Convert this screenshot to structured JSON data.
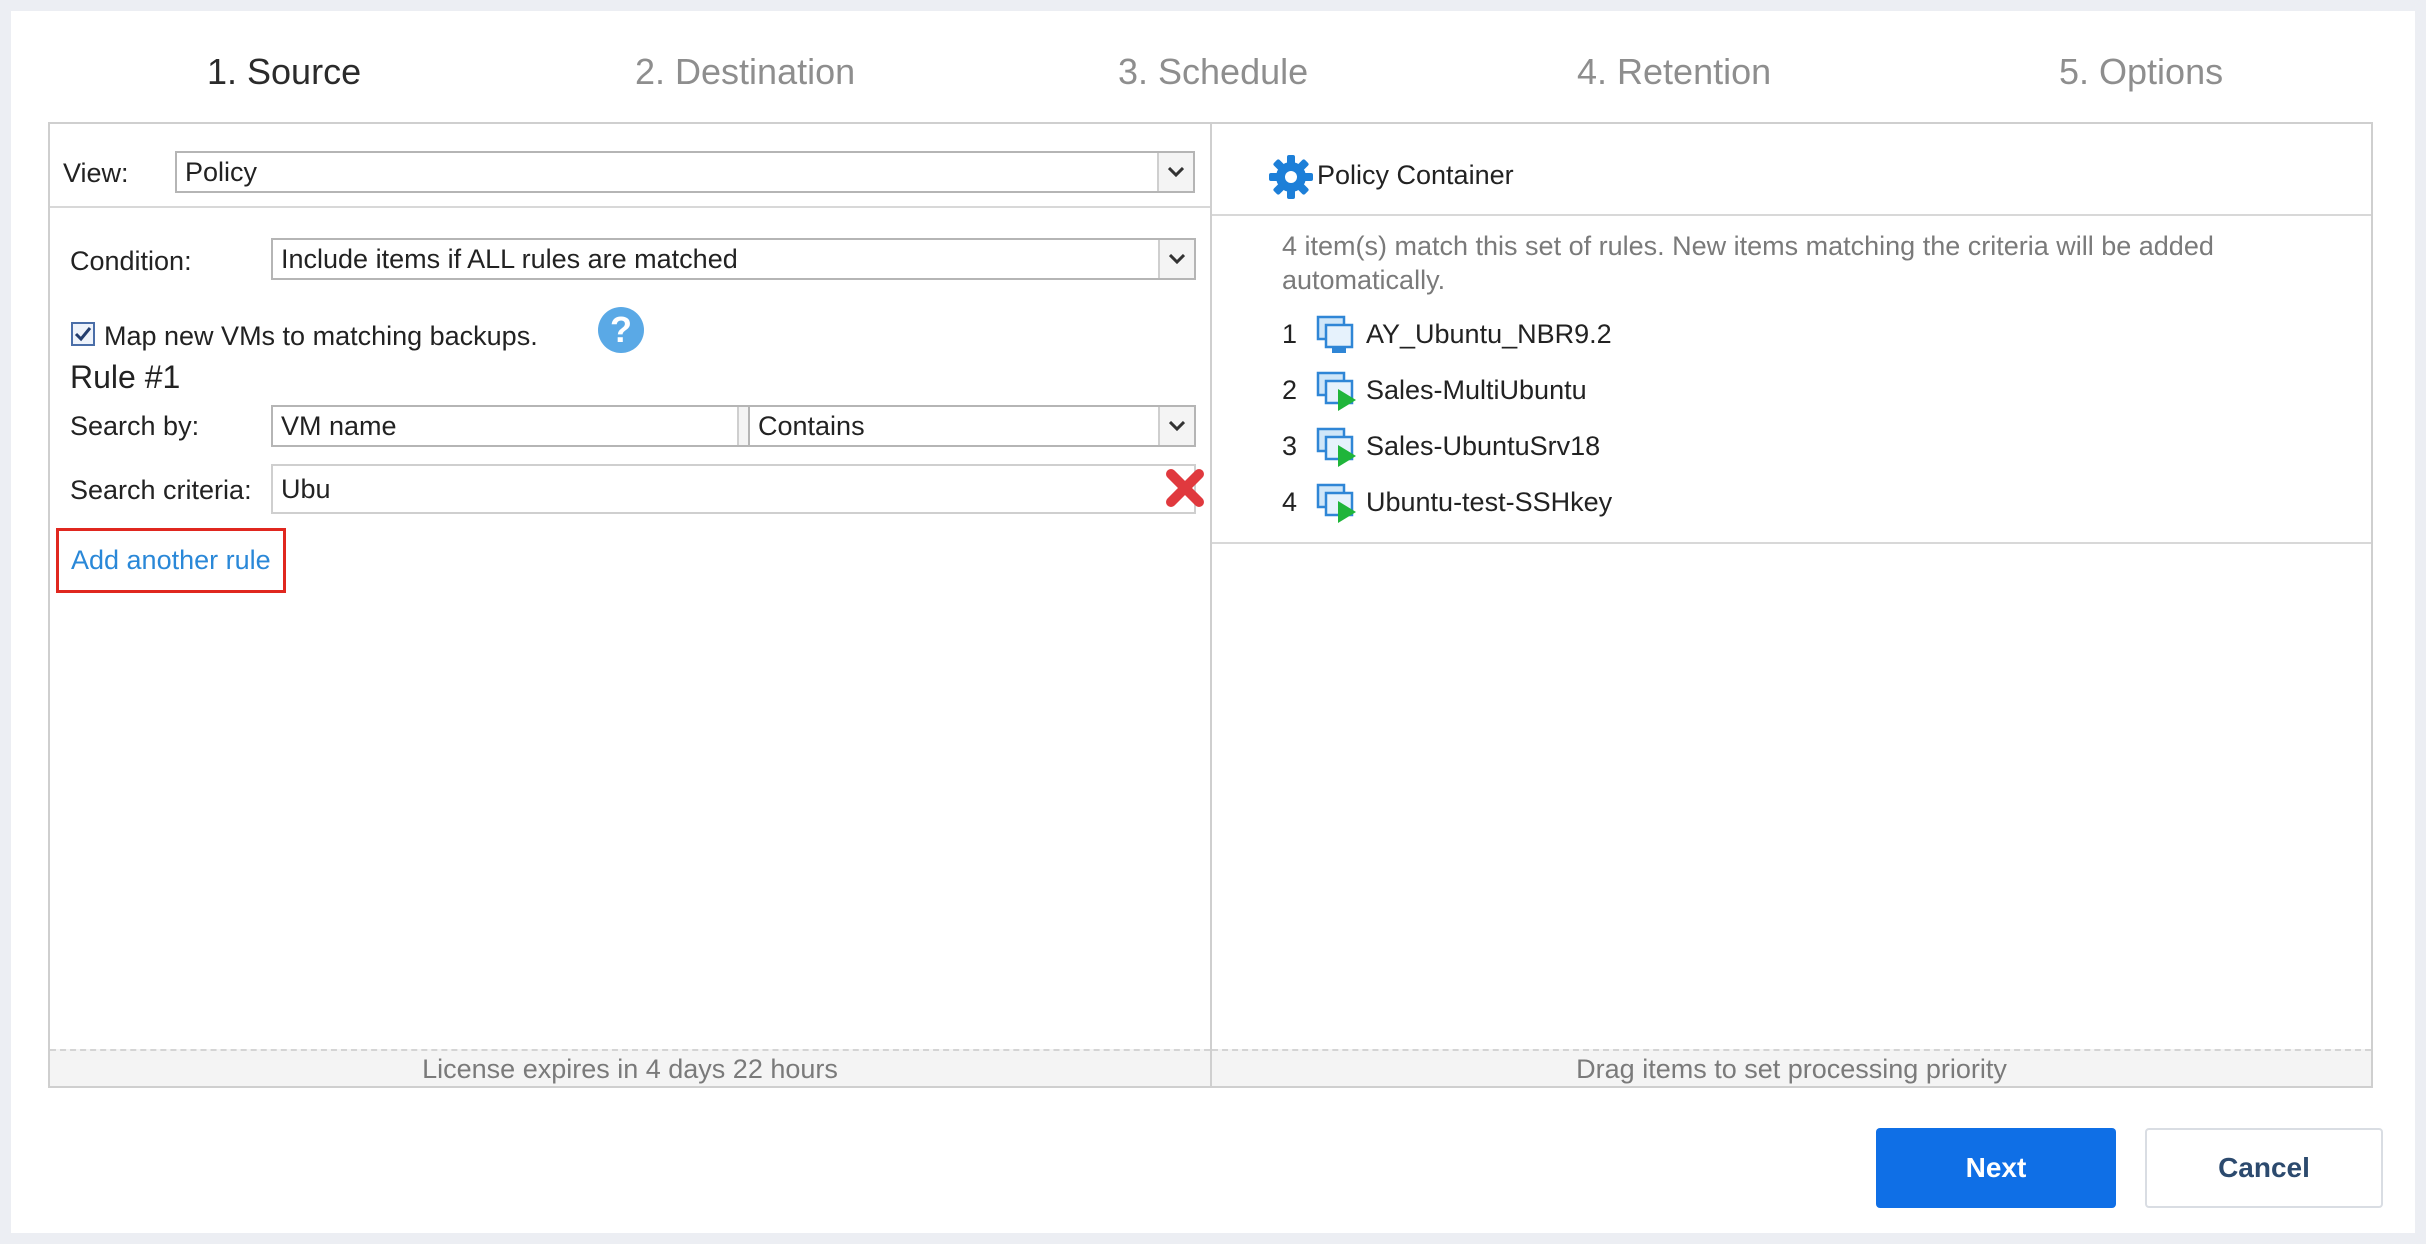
{
  "steps": [
    {
      "label": "1. Source"
    },
    {
      "label": "2. Destination"
    },
    {
      "label": "3. Schedule"
    },
    {
      "label": "4. Retention"
    },
    {
      "label": "5. Options"
    }
  ],
  "active_step": "1. Source",
  "left": {
    "view_label": "View:",
    "view_value": "Policy",
    "condition_label": "Condition:",
    "condition_value": "Include items if ALL rules are matched",
    "map_checkbox_label": "Map new VMs to matching backups.",
    "map_checkbox_checked": true,
    "help_icon": "?",
    "rule_title": "Rule #1",
    "search_by_label": "Search by:",
    "search_by_value": "VM name",
    "match_value": "Contains",
    "criteria_label": "Search criteria:",
    "criteria_value": "Ubu",
    "add_rule_link": "Add another rule",
    "footer": "License expires in 4 days 22 hours"
  },
  "right": {
    "title": "Policy Container",
    "title_icon": "gear-icon",
    "info": "4 item(s) match this set of rules. New items matching the criteria will be added automatically.",
    "items": [
      {
        "num": "1",
        "name": "AY_Ubuntu_NBR9.2",
        "icon": "vm-icon"
      },
      {
        "num": "2",
        "name": "Sales-MultiUbuntu",
        "icon": "vm-running-icon"
      },
      {
        "num": "3",
        "name": "Sales-UbuntuSrv18",
        "icon": "vm-running-icon"
      },
      {
        "num": "4",
        "name": "Ubuntu-test-SSHkey",
        "icon": "vm-running-icon"
      }
    ],
    "footer": "Drag items to set processing priority"
  },
  "buttons": {
    "next": "Next",
    "cancel": "Cancel"
  },
  "colors": {
    "accent": "#0f6fe6",
    "link": "#2a88d8",
    "highlight_border": "#e0271f",
    "delete_icon": "#e0393e",
    "running_badge": "#1fb53a"
  }
}
